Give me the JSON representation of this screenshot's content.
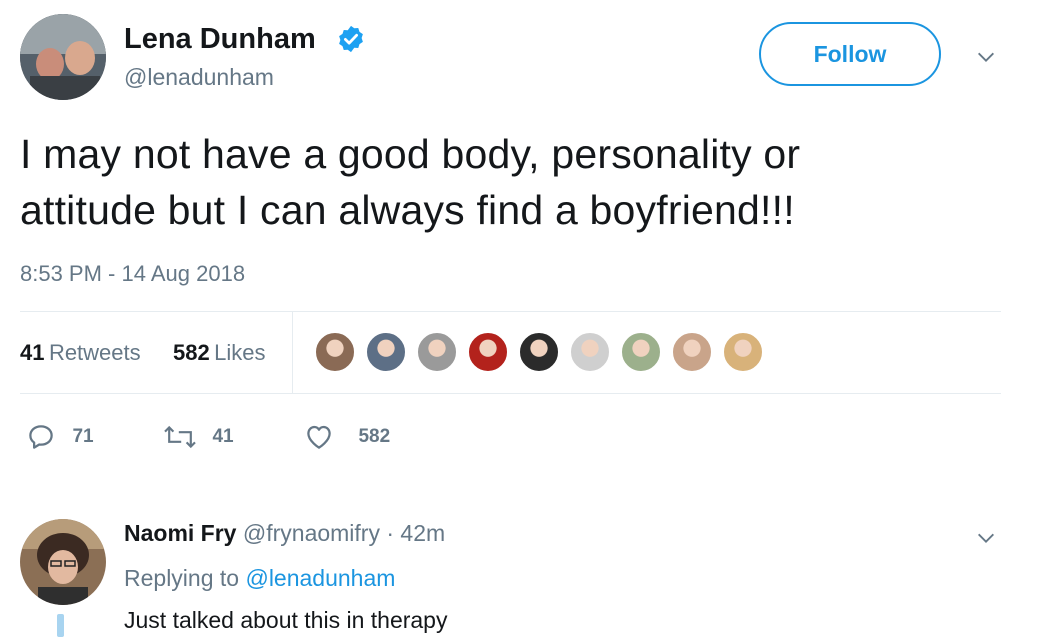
{
  "tweet": {
    "author": {
      "name": "Lena Dunham",
      "handle": "@lenadunham",
      "verified": true
    },
    "follow_label": "Follow",
    "text_line1": "I may not have a good body, personality or",
    "text_line2": "attitude but I can always find a boyfriend!!!",
    "timestamp": "8:53 PM - 14 Aug 2018",
    "stats": {
      "retweets_count": "41",
      "retweets_label": "Retweets",
      "likes_count": "582",
      "likes_label": "Likes"
    },
    "liker_avatar_colors": [
      "#8a6a55",
      "#5d6f86",
      "#9a9a9a",
      "#b3221c",
      "#2b2b2b",
      "#cfcfcf",
      "#9cb08c",
      "#c9a48a",
      "#d8b27a"
    ],
    "actions": {
      "reply_count": "71",
      "retweet_count": "41",
      "like_count": "582"
    }
  },
  "reply": {
    "author_name": "Naomi Fry",
    "author_handle": "@frynaomifry",
    "time": "· 42m",
    "replying_prefix": "Replying to",
    "replying_to": "@lenadunham",
    "text": "Just talked about this in therapy"
  },
  "colors": {
    "accent": "#1b95e0",
    "muted": "#657786",
    "divider": "#e6ecf0",
    "verified": "#1da1f2"
  }
}
